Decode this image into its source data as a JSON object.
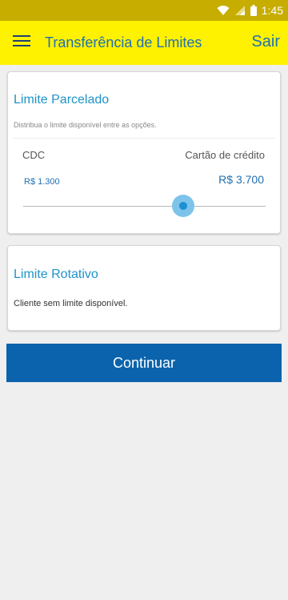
{
  "status_bar": {
    "time": "1:45",
    "icons": [
      "wifi-icon",
      "signal-icon",
      "battery-icon"
    ]
  },
  "app_bar": {
    "menu_icon": "hamburger-menu-icon",
    "title": "Transferência de Limites",
    "logout_label": "Sair"
  },
  "installment_limit": {
    "title": "Limite Parcelado",
    "hint": "Distribua o limite disponível entre as opções.",
    "left_option": "CDC",
    "right_option": "Cartão de crédito",
    "left_value": "R$ 1.300",
    "right_value": "R$ 3.700",
    "slider_fraction": 0.66
  },
  "revolving_limit": {
    "title": "Limite Rotativo",
    "message": "Cliente sem limite disponível."
  },
  "continue_label": "Continuar",
  "colors": {
    "status_bar": "#c6ad00",
    "app_bar": "#fff200",
    "accent_blue": "#1f6fb2",
    "title_blue": "#1f93c9",
    "button_blue": "#0b63ad",
    "slider_thumb": "#1d8fd3",
    "background": "#efefef"
  }
}
